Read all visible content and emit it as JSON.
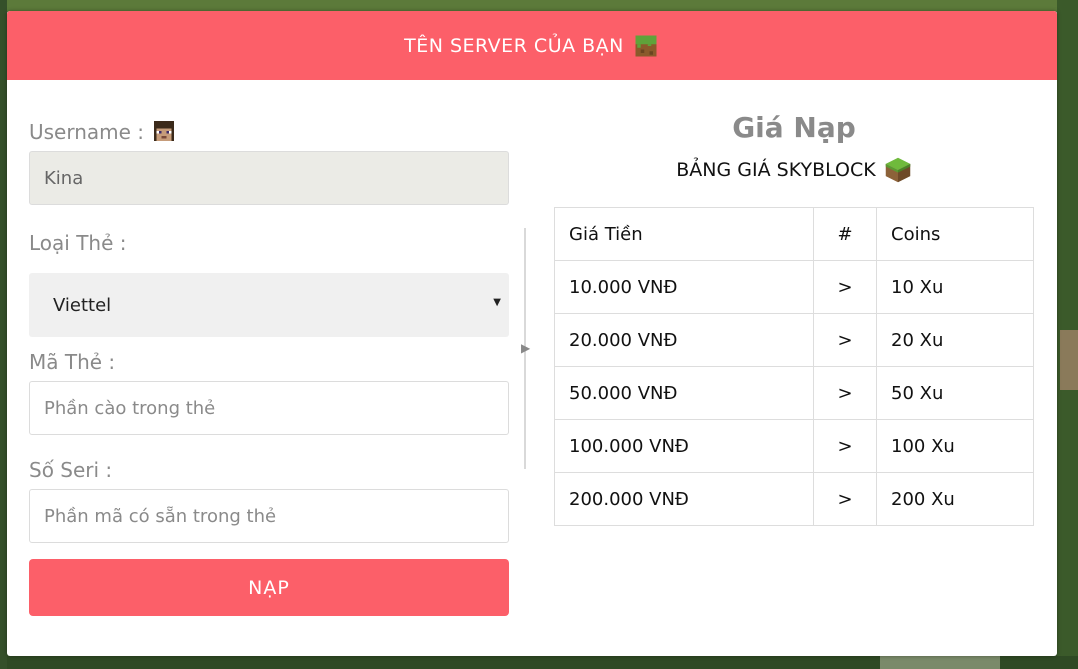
{
  "header": {
    "title": "TÊN SERVER CỦA BẠN",
    "icon": "grass-block-icon"
  },
  "form": {
    "username_label": "Username :",
    "username_value": "Kina",
    "card_type_label": "Loại Thẻ :",
    "card_type_selected": "Viettel",
    "card_code_label": "Mã Thẻ :",
    "card_code_placeholder": "Phần cào trong thẻ",
    "serial_label": "Số Seri :",
    "serial_placeholder": "Phần mã có sẵn trong thẻ",
    "submit_label": "NẠP"
  },
  "pricing": {
    "title": "Giá Nạp",
    "subtitle": "BẢNG GIÁ SKYBLOCK",
    "headers": [
      "Giá Tiền",
      "#",
      "Coins"
    ],
    "rows": [
      [
        "10.000 VNĐ",
        ">",
        "10 Xu"
      ],
      [
        "20.000 VNĐ",
        ">",
        "20 Xu"
      ],
      [
        "50.000 VNĐ",
        ">",
        "50 Xu"
      ],
      [
        "100.000 VNĐ",
        ">",
        "100 Xu"
      ],
      [
        "200.000 VNĐ",
        ">",
        "200 Xu"
      ]
    ]
  },
  "colors": {
    "accent": "#fc5f69",
    "label": "#8a8a8a",
    "readonly_bg": "#ebebe6",
    "select_bg": "#f0f0f0"
  }
}
